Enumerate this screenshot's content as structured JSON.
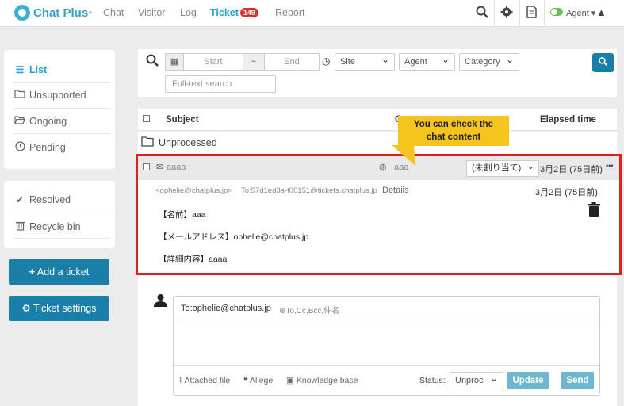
{
  "header": {
    "logo_text": "Chat Plus",
    "logo_sup": "+",
    "nav": [
      "Chat",
      "Visitor",
      "Log"
    ],
    "active_nav": "Ticket",
    "ticket_count": "149",
    "report": "Report",
    "agent_label": "Agent",
    "icons": [
      "search-icon",
      "gear-icon",
      "document-icon",
      "warning-icon"
    ]
  },
  "sidebar": {
    "items": [
      {
        "label": "List",
        "icon": "list-icon"
      },
      {
        "label": "Unsupported",
        "icon": "folder-icon"
      },
      {
        "label": "Ongoing",
        "icon": "folder-open-icon"
      },
      {
        "label": "Pending",
        "icon": "clock-icon"
      }
    ],
    "items2": [
      {
        "label": "Resolved",
        "icon": "check-icon"
      },
      {
        "label": "Recycle bin",
        "icon": "trash-icon"
      }
    ],
    "add_ticket": "Add a ticket",
    "ticket_settings": "Ticket settings"
  },
  "filter": {
    "start_placeholder": "Start",
    "range_sep": "~",
    "end_placeholder": "End",
    "site": "Site",
    "agent": "Agent",
    "category": "Category",
    "fulltext_placeholder": "Full-text search"
  },
  "table": {
    "subject_header": "Subject",
    "col2_header": "C",
    "elapsed_header": "Elapsed time",
    "unprocessed": "Unprocessed"
  },
  "ticket": {
    "subject": "aaaa",
    "site": "aaa",
    "assignee": "(未割り当て)",
    "elapsed": "3月2日 (75日前)",
    "more": "•••",
    "from": "<ophelie@chatplus.jp>",
    "to": "To:57d1ed3a-t00151@tickets.chatplus.jp",
    "details": "Details",
    "date": "3月2日 (75日前)",
    "lines": [
      "【名前】aaa",
      "【メールアドレス】ophelie@chatplus.jp",
      "【詳細内容】aaaa"
    ]
  },
  "callout": {
    "line1": "You can check the",
    "line2": "chat content"
  },
  "reply": {
    "to": "To:ophelie@chatplus.jp",
    "cc": "To,Cc,Bcc,件名",
    "attached": "Attached file",
    "allege": "Allege",
    "knowledge": "Knowledge base",
    "status_label": "Status:",
    "status_value": "Unproc",
    "update": "Update",
    "send": "Send"
  }
}
